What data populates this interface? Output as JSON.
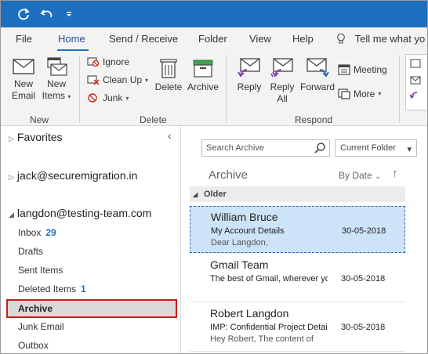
{
  "tabs": [
    "File",
    "Home",
    "Send / Receive",
    "Folder",
    "View",
    "Help"
  ],
  "tell_me": "Tell me what yo",
  "ribbon": {
    "new_email": [
      "New",
      "Email"
    ],
    "new_items": [
      "New",
      "Items"
    ],
    "ignore": "Ignore",
    "clean_up": "Clean Up",
    "junk": "Junk",
    "delete": "Delete",
    "archive": "Archive",
    "reply": "Reply",
    "reply_all": [
      "Reply",
      "All"
    ],
    "forward": "Forward",
    "meeting": "Meeting",
    "more": "More",
    "groups": {
      "new": "New",
      "delete": "Delete",
      "respond": "Respond"
    }
  },
  "nav": {
    "favorites": "Favorites",
    "account1": "jack@securemigration.in",
    "account2": "langdon@testing-team.com",
    "folders": [
      {
        "name": "Inbox",
        "count": "29"
      },
      {
        "name": "Drafts",
        "count": ""
      },
      {
        "name": "Sent Items",
        "count": ""
      },
      {
        "name": "Deleted Items",
        "count": "1"
      },
      {
        "name": "Archive",
        "count": ""
      },
      {
        "name": "Junk Email",
        "count": ""
      },
      {
        "name": "Outbox",
        "count": ""
      }
    ]
  },
  "list": {
    "search_placeholder": "Search Archive",
    "scope": "Current Folder",
    "title": "Archive",
    "sort": "By Date",
    "group": "Older",
    "messages": [
      {
        "from": "William Bruce",
        "subject": "My Account Details",
        "preview": "Dear Langdon,",
        "date": "30-05-2018"
      },
      {
        "from": "Gmail Team",
        "subject": "The best of Gmail, wherever you are",
        "preview": "",
        "date": "30-05-2018"
      },
      {
        "from": "Robert Langdon",
        "subject": "IMP: Confidential Project Details",
        "preview": "Hey Robert,  The content of",
        "date": "30-05-2018"
      }
    ]
  },
  "colors": {
    "titlebar": "#1f6fc0",
    "selection": "#cde3f7",
    "highlight_box": "#d11a1a"
  }
}
